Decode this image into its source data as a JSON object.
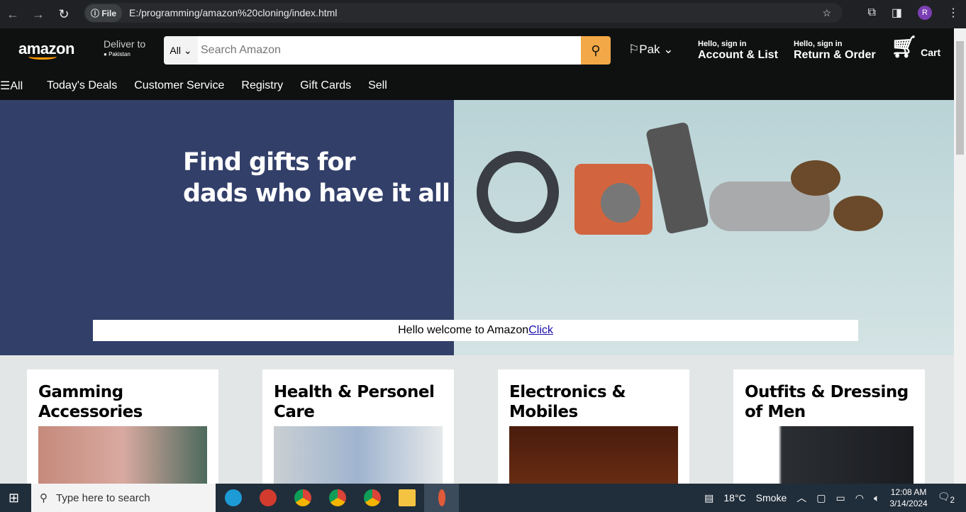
{
  "browser": {
    "file_label": "File",
    "url": "E:/programming/amazon%20cloning/index.html",
    "avatar": "R"
  },
  "header": {
    "logo": "amazon",
    "deliver_to": "Deliver to",
    "location": "Pakistan",
    "search_category": "All",
    "search_placeholder": "Search Amazon",
    "lang": "Pak",
    "account_greeting": "Hello, sign in",
    "account_label": "Account & List",
    "returns_greeting": "Hello, sign in",
    "returns_label": "Return & Order",
    "cart_label": "Cart"
  },
  "nav": {
    "all": "All",
    "items": [
      "Today's Deals",
      "Customer Service",
      "Registry",
      "Gift Cards",
      "Sell"
    ]
  },
  "hero": {
    "line1": "Find gifts for",
    "line2": "dads who have it all",
    "welcome": "Hello welcome to Amazon",
    "link": "Click"
  },
  "cards": [
    {
      "title": "Gamming Accessories"
    },
    {
      "title": "Health & Personel Care"
    },
    {
      "title": "Electronics & Mobiles"
    },
    {
      "title": "Outfits & Dressing of Men"
    }
  ],
  "taskbar": {
    "search": "Type here to search",
    "weather": "18°C",
    "weather_desc": "Smoke",
    "time": "12:08 AM",
    "date": "3/14/2024",
    "notifications": "2"
  }
}
